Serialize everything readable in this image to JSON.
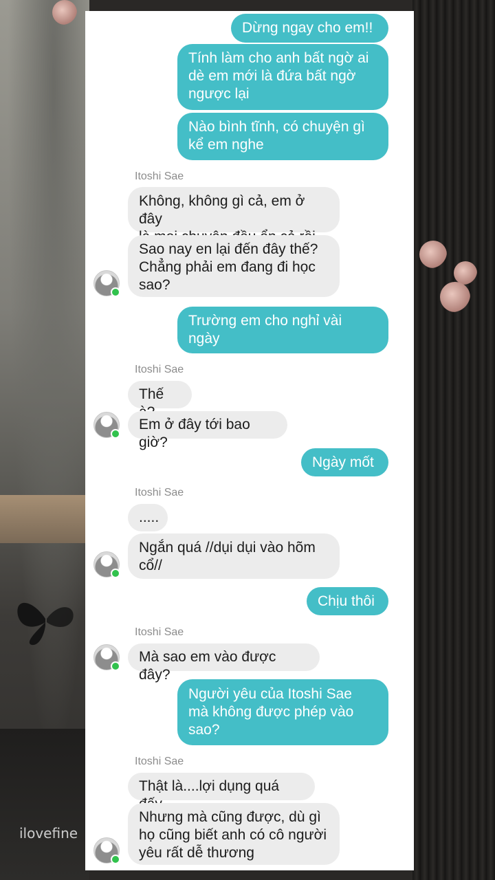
{
  "contact_name": "Itoshi Sae",
  "watermark": "ilovefine",
  "colors": {
    "outgoing": "#44bec7",
    "incoming": "#ececec",
    "online": "#31c24d"
  },
  "messages": [
    {
      "dir": "out",
      "lines": [
        "Dừng ngay cho em!!"
      ]
    },
    {
      "dir": "out",
      "lines": [
        "Tính làm cho anh bất ngờ ai",
        "dè em mới là đứa bất ngờ",
        "ngược lại"
      ]
    },
    {
      "dir": "out",
      "lines": [
        "Nào bình tĩnh, có chuyện gì",
        "kể em nghe"
      ]
    },
    {
      "dir": "in",
      "lines": [
        "Không, không gì cả, em ở đây",
        "là mọi chuyện đều ổn cả rồi"
      ]
    },
    {
      "dir": "in",
      "lines": [
        "Sao nay en lại đến đây thế?",
        "Chẳng phải em đang đi học",
        "sao?"
      ]
    },
    {
      "dir": "out",
      "lines": [
        "Trường em cho nghỉ vài",
        "ngày"
      ]
    },
    {
      "dir": "in",
      "lines": [
        "Thế à?"
      ]
    },
    {
      "dir": "in",
      "lines": [
        "Em ở đây tới bao giờ?"
      ]
    },
    {
      "dir": "out",
      "lines": [
        "Ngày mốt"
      ]
    },
    {
      "dir": "in",
      "lines": [
        "....."
      ]
    },
    {
      "dir": "in",
      "lines": [
        "Ngắn quá //dụi dụi vào hõm",
        "cổ//"
      ]
    },
    {
      "dir": "out",
      "lines": [
        "Chịu thôi"
      ]
    },
    {
      "dir": "in",
      "lines": [
        "Mà sao em vào được đây?"
      ]
    },
    {
      "dir": "out",
      "lines": [
        "Người yêu của Itoshi Sae",
        "mà không được phép vào",
        "sao?"
      ]
    },
    {
      "dir": "in",
      "lines": [
        "Thật là....lợi dụng quá đấy"
      ]
    },
    {
      "dir": "in",
      "lines": [
        "Nhưng mà cũng được, dù gì",
        "họ cũng biết anh có cô người",
        "yêu rất dễ thương"
      ]
    }
  ]
}
